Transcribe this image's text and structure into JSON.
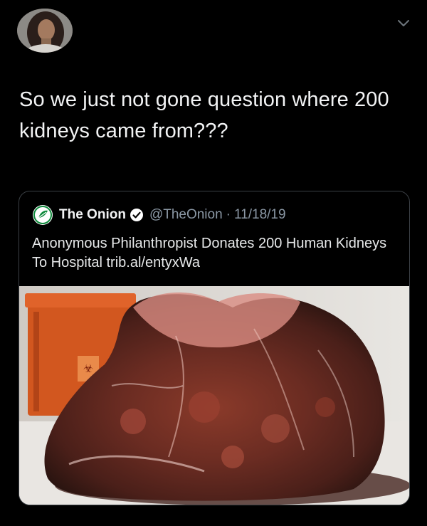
{
  "tweet": {
    "text": "So we just not gone question where 200 kidneys came from???",
    "author": {
      "name": "",
      "handle": "",
      "avatar_icon": "user-avatar"
    },
    "menu_icon": "chevron-down-icon"
  },
  "quoted_tweet": {
    "name": "The Onion",
    "handle": "@TheOnion",
    "separator": "·",
    "date": "11/18/19",
    "text": "Anonymous Philanthropist Donates 200 Human Kidneys To Hospital trib.al/entyxWa",
    "logo_icon": "onion-logo-icon",
    "verified_icon": "verified-badge-icon",
    "media": {
      "icon": "photo",
      "container_label": "BIOHAZARD"
    }
  },
  "colors": {
    "background": "#000000",
    "text_primary": "#e7e9ea",
    "text_secondary": "#8b98a5",
    "border": "#3a3f44",
    "onion_green": "#0f8a3c"
  }
}
